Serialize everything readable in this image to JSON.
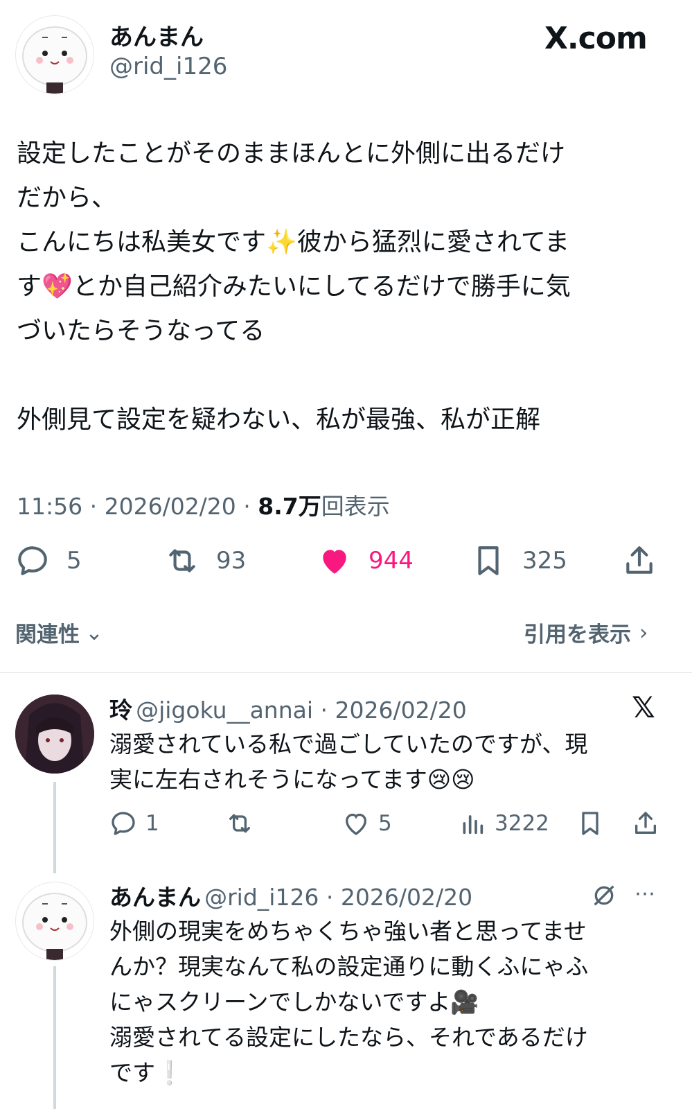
{
  "main_post": {
    "author_name": "あんまん",
    "author_handle": "@rid_i126",
    "site_label": "X.com",
    "text": "設定したことがそのままほんとに外側に出るだけ\nだから、\nこんにちは私美女です✨彼から猛烈に愛されてま\nす💖とか自己紹介みたいにしてるだけで勝手に気\nづいたらそうなってる\n\n外側見て設定を疑わない、私が最強、私が正解",
    "time": "11:56",
    "date": "2026/02/20",
    "views_value": "8.7万",
    "views_label": "回表示",
    "replies": "5",
    "reposts": "93",
    "likes": "944",
    "bookmarks": "325",
    "sort_label": "関連性",
    "quotes_label": "引用を表示"
  },
  "replies": [
    {
      "author_name": "玲",
      "author_handle": "@jigoku__annai",
      "date": "2026/02/20",
      "text": "溺愛されている私で過ごしていたのですが、現\n実に左右されそうになってます😢😢",
      "replies": "1",
      "likes": "5",
      "views": "3222"
    },
    {
      "author_name": "あんまん",
      "author_handle": "@rid_i126",
      "date": "2026/02/20",
      "text": "外側の現実をめちゃくちゃ強い者と思ってませ\nんか？現実なんて私の設定通りに動くふにゃふ\nにゃスクリーンでしかないですよ🎥\n溺愛されてる設定にしたなら、それであるだけ\nです❕"
    }
  ],
  "colors": {
    "like": "#f91880",
    "secondary_text": "#536471",
    "primary_text": "#0f1419"
  }
}
